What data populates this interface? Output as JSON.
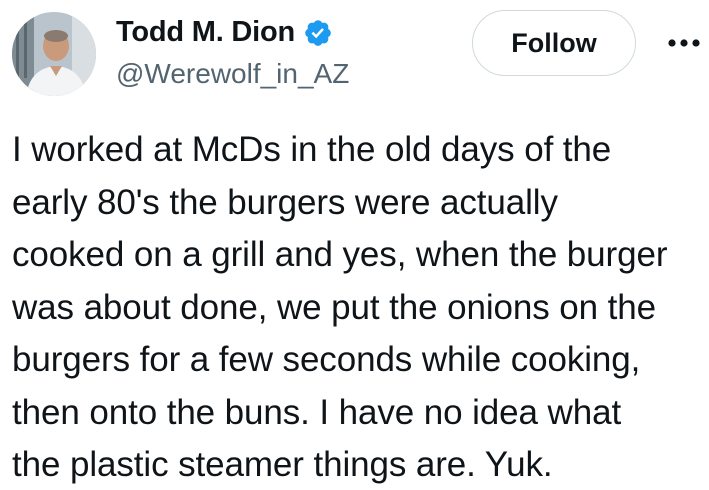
{
  "author": {
    "display_name": "Todd M. Dion",
    "handle": "@Werewolf_in_AZ",
    "verified": true
  },
  "actions": {
    "follow_label": "Follow",
    "more_icon": "more-horizontal-icon"
  },
  "tweet": {
    "lines": [
      "I worked at McDs in the old days of the",
      "early 80's the burgers were actually",
      "cooked on a grill and yes, when the burger",
      "was about done, we put the onions on the",
      "burgers for a few seconds while cooking,",
      "then onto the buns. I have no idea what",
      "the plastic steamer things are. Yuk."
    ]
  },
  "colors": {
    "verified_badge": "#1d9bf0",
    "text_primary": "#0f1419",
    "text_secondary": "#536471",
    "button_border": "#cfd9de"
  }
}
